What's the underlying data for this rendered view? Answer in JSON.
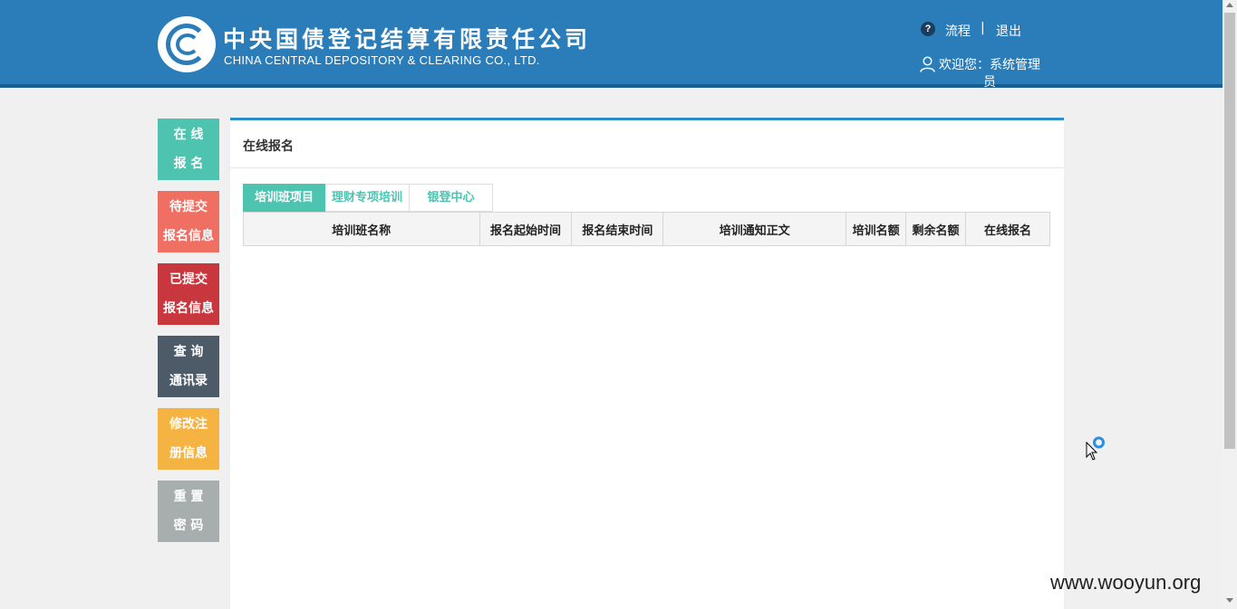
{
  "header": {
    "company_cn": "中央国债登记结算有限责任公司",
    "company_en": "CHINA CENTRAL DEPOSITORY & CLEARING CO., LTD.",
    "help_icon_glyph": "?",
    "flow_link": "流程",
    "separator": "|",
    "logout_link": "退出",
    "welcome_text": "欢迎您：系统管理员",
    "colors": {
      "bar": "#2a7db8",
      "bar_bottom": "#1a5d8f"
    }
  },
  "sidebar": {
    "items": [
      {
        "line1": "在 线",
        "line2": "报 名",
        "color": "#4ec3b0"
      },
      {
        "line1": "待提交",
        "line2": "报名信息",
        "color": "#ef6f63"
      },
      {
        "line1": "已提交",
        "line2": "报名信息",
        "color": "#c8363e"
      },
      {
        "line1": "查 询",
        "line2": "通讯录",
        "color": "#4d5b69"
      },
      {
        "line1": "修改注",
        "line2": "册信息",
        "color": "#f5b342"
      },
      {
        "line1": "重 置",
        "line2": "密 码",
        "color": "#a8adad"
      }
    ]
  },
  "main": {
    "title": "在线报名",
    "tabs": [
      "培训班项目",
      "理财专项培训",
      "银登中心"
    ],
    "table_headers": [
      "培训班名称",
      "报名起始时间",
      "报名结束时间",
      "培训通知正文",
      "培训名额",
      "剩余名额",
      "在线报名"
    ],
    "accent": "#4ec3b0"
  },
  "watermark": "www.wooyun.org"
}
